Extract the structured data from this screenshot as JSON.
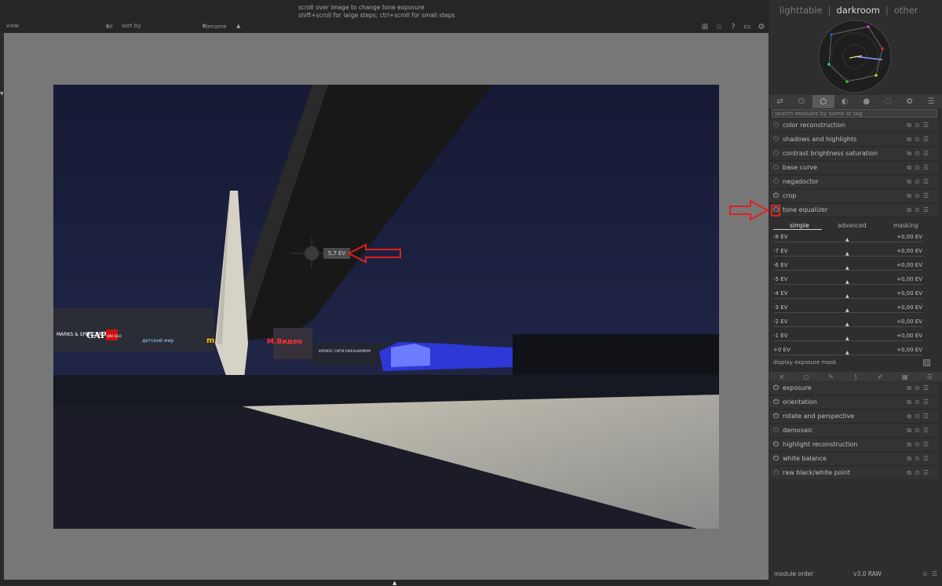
{
  "hint": {
    "line1": "scroll over image to change tone exposure",
    "line2": "shift+scroll for large steps; ctrl+scroll for small steps"
  },
  "filterbar": {
    "view": "view",
    "all": "all",
    "sort_by": "sort by",
    "filename": "filename"
  },
  "views": {
    "lighttable": "lighttable",
    "darkroom": "darkroom",
    "other": "other"
  },
  "search_placeholder": "search modules by name or tag",
  "modules_top": [
    {
      "name": "color reconstruction",
      "enabled": false
    },
    {
      "name": "shadows and highlights",
      "enabled": false
    },
    {
      "name": "contrast brightness saturation",
      "enabled": false
    },
    {
      "name": "base curve",
      "enabled": false
    },
    {
      "name": "negadoctor",
      "enabled": false
    },
    {
      "name": "crop",
      "enabled": true
    },
    {
      "name": "tone equalizer",
      "enabled": true
    }
  ],
  "tone_equalizer": {
    "tabs": [
      "simple",
      "advanced",
      "masking"
    ],
    "active_tab": "simple",
    "sliders": [
      {
        "label": "-8 EV",
        "value": "+0,00 EV"
      },
      {
        "label": "-7 EV",
        "value": "+0,00 EV"
      },
      {
        "label": "-6 EV",
        "value": "+0,00 EV"
      },
      {
        "label": "-5 EV",
        "value": "+0,00 EV"
      },
      {
        "label": "-4 EV",
        "value": "+0,00 EV"
      },
      {
        "label": "-3 EV",
        "value": "+0,00 EV"
      },
      {
        "label": "-2 EV",
        "value": "+0,00 EV"
      },
      {
        "label": "-1 EV",
        "value": "+0,00 EV"
      },
      {
        "label": "+0 EV",
        "value": "+0,00 EV"
      }
    ],
    "display_mask": "display exposure mask"
  },
  "modules_bottom": [
    {
      "name": "exposure",
      "enabled": true
    },
    {
      "name": "orientation",
      "enabled": true
    },
    {
      "name": "rotate and perspective",
      "enabled": true
    },
    {
      "name": "demosaic",
      "enabled": false
    },
    {
      "name": "highlight reconstruction",
      "enabled": true
    },
    {
      "name": "white balance",
      "enabled": true
    },
    {
      "name": "raw black/white point",
      "enabled": false
    }
  ],
  "footer": {
    "module_order": "module order",
    "version": "v3.0 RAW"
  },
  "ev_readout": "5,7 EV",
  "photo_signs": {
    "marks_spencer": "MARKS & SPENCER",
    "gap": "GAP",
    "uniqlo": "UNI QLO",
    "detsky": "детский мир",
    "mvideo": "M.Видео",
    "kinoplex": "КРОКУС СИТИ ОКЕАНАРИУМ"
  },
  "colors": {
    "accent_red": "#e02020",
    "panel_bg": "#2e2e2e",
    "canvas_bg": "#777777"
  }
}
